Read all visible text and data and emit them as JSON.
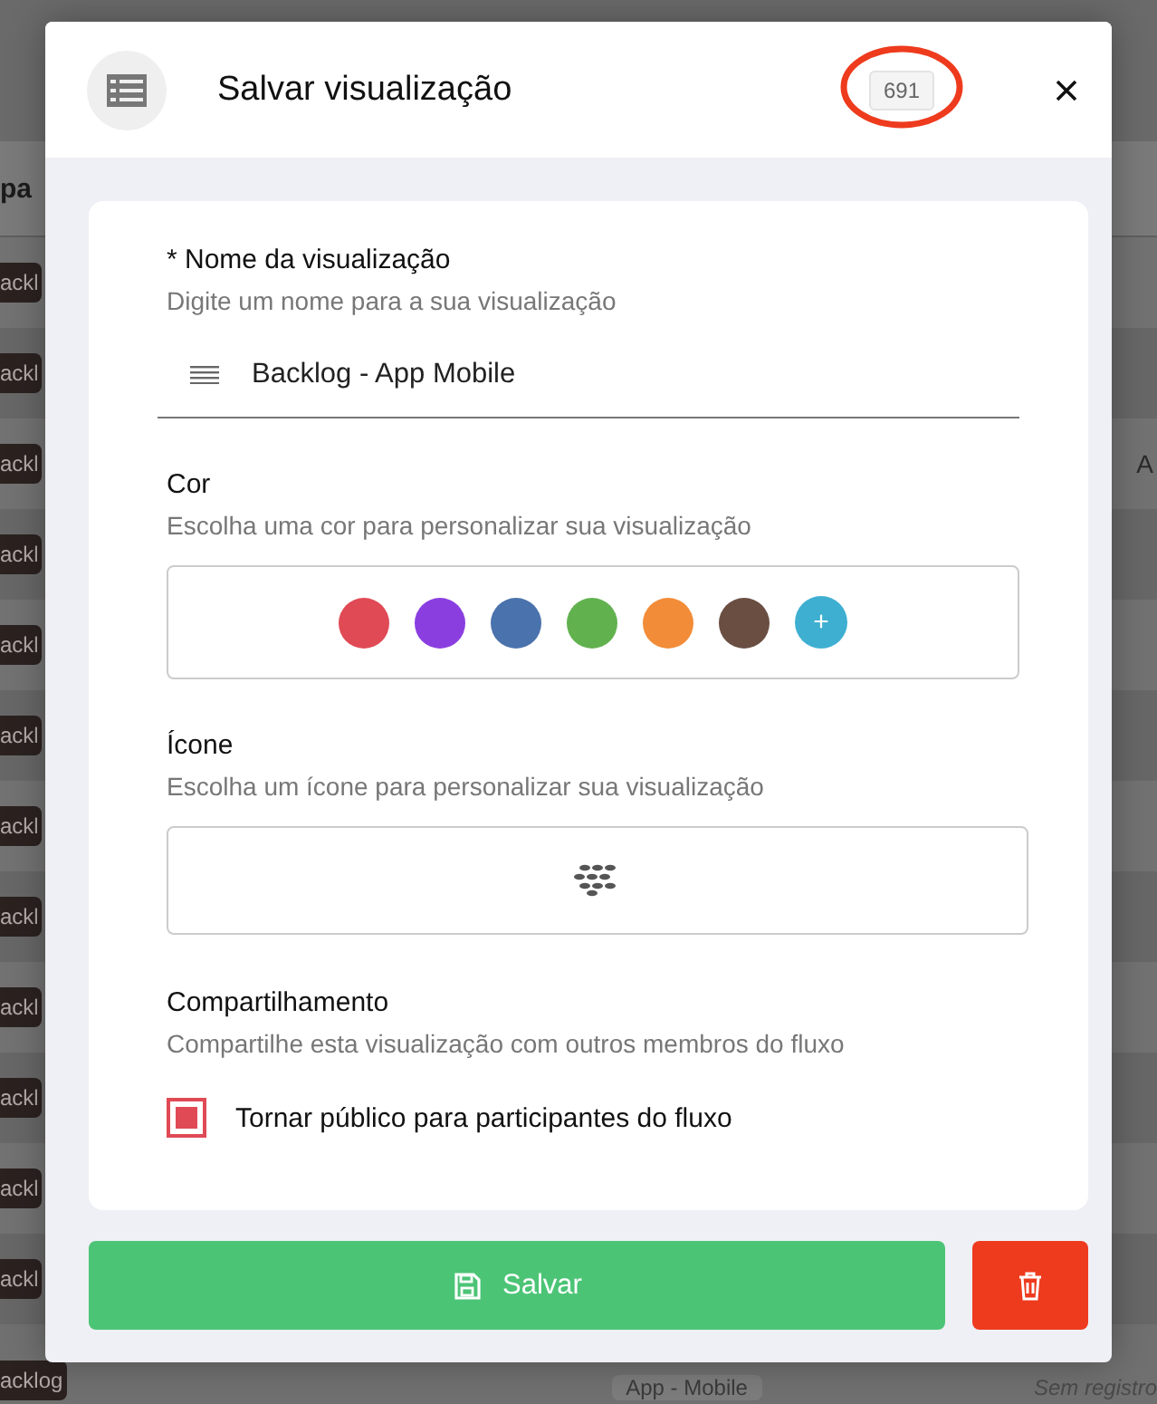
{
  "background": {
    "column_header": "pa",
    "tags": [
      "ackl",
      "ackl",
      "ackl",
      "ackl",
      "ackl",
      "ackl",
      "ackl",
      "ackl",
      "ackl",
      "ackl",
      "ackl",
      "ackl",
      "acklog"
    ],
    "right_letter": "A",
    "bottom_chip": "App - Mobile",
    "bottom_note": "Sem registro"
  },
  "modal": {
    "title": "Salvar visualização",
    "badge": "691",
    "badge_highlighted": true,
    "name_field": {
      "label": "* Nome da visualização",
      "hint": "Digite um nome para a sua visualização",
      "value": "Backlog - App Mobile"
    },
    "color_field": {
      "label": "Cor",
      "hint": "Escolha uma cor para personalizar sua visualização",
      "colors": [
        {
          "color": "#e04a55"
        },
        {
          "color": "#8a3ee0"
        },
        {
          "color": "#4a72ac"
        },
        {
          "color": "#62b14f"
        },
        {
          "color": "#f28c38"
        },
        {
          "color": "#6a4e42"
        }
      ],
      "add_label": "+"
    },
    "icon_field": {
      "label": "Ícone",
      "hint": "Escolha um ícone para personalizar sua visualização"
    },
    "sharing": {
      "label": "Compartilhamento",
      "hint": "Compartilhe esta visualização com outros membros do fluxo",
      "checkbox": {
        "label": "Tornar público para participantes do fluxo",
        "checked": true
      }
    },
    "save_button": "Salvar"
  }
}
